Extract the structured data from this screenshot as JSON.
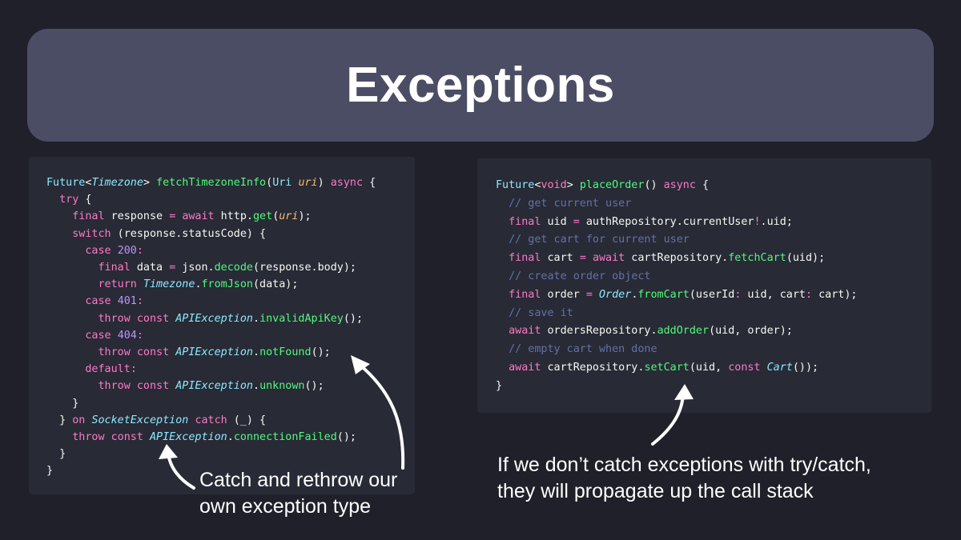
{
  "title": "Exceptions",
  "colors": {
    "background": "#1f2029",
    "title_bar": "#4b4d64",
    "code_panel": "#282a36",
    "keyword": "#ff79c6",
    "type": "#8be9fd",
    "function": "#50fa7b",
    "parameter": "#ffb86c",
    "number": "#bd93f9",
    "comment": "#6272a4",
    "text": "#f8f8f2"
  },
  "left_code": [
    [
      [
        "Future",
        "t"
      ],
      [
        "<",
        "d"
      ],
      [
        "Timezone",
        "ti"
      ],
      [
        "> ",
        "d"
      ],
      [
        "fetchTimezoneInfo",
        "f"
      ],
      [
        "(",
        "d"
      ],
      [
        "Uri",
        "t"
      ],
      [
        " ",
        "d"
      ],
      [
        "uri",
        "p"
      ],
      [
        ") ",
        "d"
      ],
      [
        "async",
        "k"
      ],
      [
        " {",
        "d"
      ]
    ],
    [
      [
        "  ",
        "d"
      ],
      [
        "try",
        "k"
      ],
      [
        " {",
        "d"
      ]
    ],
    [
      [
        "    ",
        "d"
      ],
      [
        "final",
        "k"
      ],
      [
        " response ",
        "d"
      ],
      [
        "=",
        "k"
      ],
      [
        " ",
        "d"
      ],
      [
        "await",
        "k"
      ],
      [
        " http.",
        "d"
      ],
      [
        "get",
        "f"
      ],
      [
        "(",
        "d"
      ],
      [
        "uri",
        "p"
      ],
      [
        ");",
        "d"
      ]
    ],
    [
      [
        "    ",
        "d"
      ],
      [
        "switch",
        "k"
      ],
      [
        " (response.statusCode) {",
        "d"
      ]
    ],
    [
      [
        "      ",
        "d"
      ],
      [
        "case",
        "k"
      ],
      [
        " ",
        "d"
      ],
      [
        "200",
        "n"
      ],
      [
        ":",
        "k"
      ]
    ],
    [
      [
        "        ",
        "d"
      ],
      [
        "final",
        "k"
      ],
      [
        " data ",
        "d"
      ],
      [
        "=",
        "k"
      ],
      [
        " json.",
        "d"
      ],
      [
        "decode",
        "f"
      ],
      [
        "(response.body);",
        "d"
      ]
    ],
    [
      [
        "        ",
        "d"
      ],
      [
        "return",
        "k"
      ],
      [
        " ",
        "d"
      ],
      [
        "Timezone",
        "ti"
      ],
      [
        ".",
        "d"
      ],
      [
        "fromJson",
        "f"
      ],
      [
        "(data);",
        "d"
      ]
    ],
    [
      [
        "      ",
        "d"
      ],
      [
        "case",
        "k"
      ],
      [
        " ",
        "d"
      ],
      [
        "401",
        "n"
      ],
      [
        ":",
        "k"
      ]
    ],
    [
      [
        "        ",
        "d"
      ],
      [
        "throw",
        "k"
      ],
      [
        " ",
        "d"
      ],
      [
        "const",
        "k"
      ],
      [
        " ",
        "d"
      ],
      [
        "APIException",
        "ti"
      ],
      [
        ".",
        "d"
      ],
      [
        "invalidApiKey",
        "f"
      ],
      [
        "();",
        "d"
      ]
    ],
    [
      [
        "      ",
        "d"
      ],
      [
        "case",
        "k"
      ],
      [
        " ",
        "d"
      ],
      [
        "404",
        "n"
      ],
      [
        ":",
        "k"
      ]
    ],
    [
      [
        "        ",
        "d"
      ],
      [
        "throw",
        "k"
      ],
      [
        " ",
        "d"
      ],
      [
        "const",
        "k"
      ],
      [
        " ",
        "d"
      ],
      [
        "APIException",
        "ti"
      ],
      [
        ".",
        "d"
      ],
      [
        "notFound",
        "f"
      ],
      [
        "();",
        "d"
      ]
    ],
    [
      [
        "      ",
        "d"
      ],
      [
        "default",
        "k"
      ],
      [
        ":",
        "k"
      ]
    ],
    [
      [
        "        ",
        "d"
      ],
      [
        "throw",
        "k"
      ],
      [
        " ",
        "d"
      ],
      [
        "const",
        "k"
      ],
      [
        " ",
        "d"
      ],
      [
        "APIException",
        "ti"
      ],
      [
        ".",
        "d"
      ],
      [
        "unknown",
        "f"
      ],
      [
        "();",
        "d"
      ]
    ],
    [
      [
        "    }",
        "d"
      ]
    ],
    [
      [
        "  } ",
        "d"
      ],
      [
        "on",
        "k"
      ],
      [
        " ",
        "d"
      ],
      [
        "SocketException",
        "ti"
      ],
      [
        " ",
        "d"
      ],
      [
        "catch",
        "k"
      ],
      [
        " (_) {",
        "d"
      ]
    ],
    [
      [
        "    ",
        "d"
      ],
      [
        "throw",
        "k"
      ],
      [
        " ",
        "d"
      ],
      [
        "const",
        "k"
      ],
      [
        " ",
        "d"
      ],
      [
        "APIException",
        "ti"
      ],
      [
        ".",
        "d"
      ],
      [
        "connectionFailed",
        "f"
      ],
      [
        "();",
        "d"
      ]
    ],
    [
      [
        "  }",
        "d"
      ]
    ],
    [
      [
        "}",
        "d"
      ]
    ]
  ],
  "right_code": [
    [
      [
        "Future",
        "t"
      ],
      [
        "<",
        "d"
      ],
      [
        "void",
        "k"
      ],
      [
        "> ",
        "d"
      ],
      [
        "placeOrder",
        "f"
      ],
      [
        "() ",
        "d"
      ],
      [
        "async",
        "k"
      ],
      [
        " {",
        "d"
      ]
    ],
    [
      [
        "  ",
        "d"
      ],
      [
        "// get current user",
        "c"
      ]
    ],
    [
      [
        "  ",
        "d"
      ],
      [
        "final",
        "k"
      ],
      [
        " uid ",
        "d"
      ],
      [
        "=",
        "k"
      ],
      [
        " authRepository.currentUser",
        "d"
      ],
      [
        "!",
        "k"
      ],
      [
        ".uid;",
        "d"
      ]
    ],
    [
      [
        "  ",
        "d"
      ],
      [
        "// get cart for current user",
        "c"
      ]
    ],
    [
      [
        "  ",
        "d"
      ],
      [
        "final",
        "k"
      ],
      [
        " cart ",
        "d"
      ],
      [
        "=",
        "k"
      ],
      [
        " ",
        "d"
      ],
      [
        "await",
        "k"
      ],
      [
        " cartRepository.",
        "d"
      ],
      [
        "fetchCart",
        "f"
      ],
      [
        "(uid);",
        "d"
      ]
    ],
    [
      [
        "  ",
        "d"
      ],
      [
        "// create order object",
        "c"
      ]
    ],
    [
      [
        "  ",
        "d"
      ],
      [
        "final",
        "k"
      ],
      [
        " order ",
        "d"
      ],
      [
        "=",
        "k"
      ],
      [
        " ",
        "d"
      ],
      [
        "Order",
        "ti"
      ],
      [
        ".",
        "d"
      ],
      [
        "fromCart",
        "f"
      ],
      [
        "(userId",
        "d"
      ],
      [
        ":",
        "k"
      ],
      [
        " uid, cart",
        "d"
      ],
      [
        ":",
        "k"
      ],
      [
        " cart);",
        "d"
      ]
    ],
    [
      [
        "  ",
        "d"
      ],
      [
        "// save it",
        "c"
      ]
    ],
    [
      [
        "  ",
        "d"
      ],
      [
        "await",
        "k"
      ],
      [
        " ordersRepository.",
        "d"
      ],
      [
        "addOrder",
        "f"
      ],
      [
        "(uid, order);",
        "d"
      ]
    ],
    [
      [
        "  ",
        "d"
      ],
      [
        "// empty cart when done",
        "c"
      ]
    ],
    [
      [
        "  ",
        "d"
      ],
      [
        "await",
        "k"
      ],
      [
        " cartRepository.",
        "d"
      ],
      [
        "setCart",
        "f"
      ],
      [
        "(uid, ",
        "d"
      ],
      [
        "const",
        "k"
      ],
      [
        " ",
        "d"
      ],
      [
        "Cart",
        "ti"
      ],
      [
        "());",
        "d"
      ]
    ],
    [
      [
        "}",
        "d"
      ]
    ]
  ],
  "left_caption": [
    "Catch and rethrow our",
    "own exception type"
  ],
  "right_caption": [
    "If we don’t catch exceptions with try/catch,",
    "they will propagate up the call stack"
  ]
}
